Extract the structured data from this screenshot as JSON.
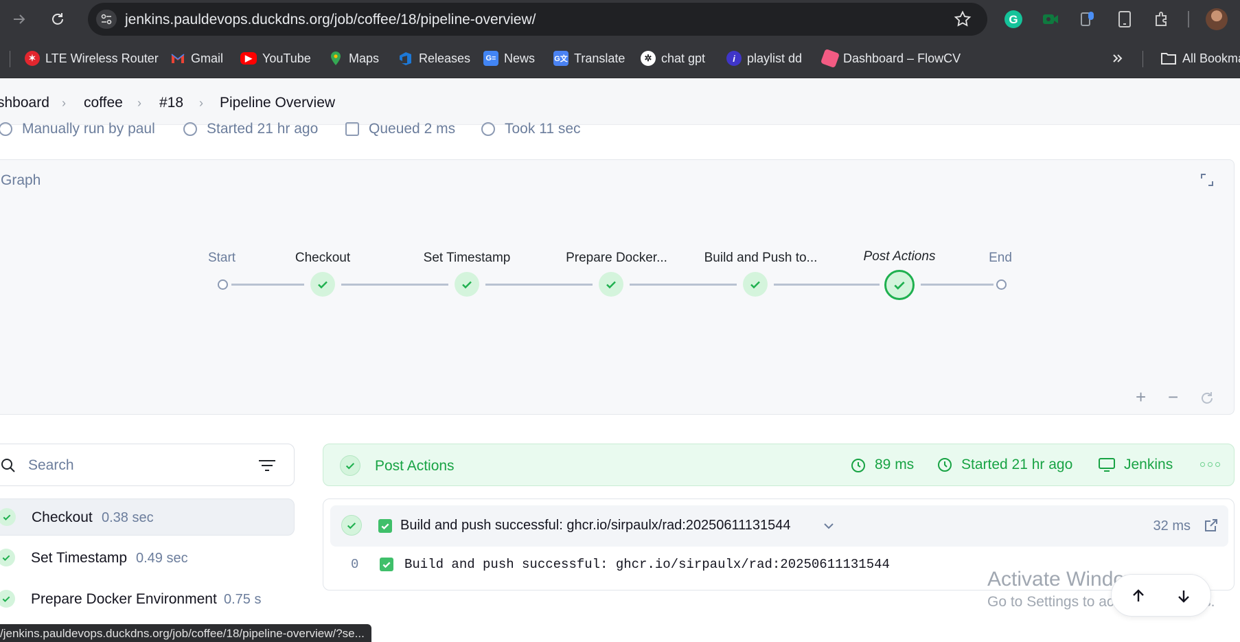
{
  "browser": {
    "url": "jenkins.pauldevops.duckdns.org/job/coffee/18/pipeline-overview/",
    "bookmarks": [
      {
        "label": "LTE Wireless Router",
        "icon": "router-bookmark-icon",
        "color": "#e3262e"
      },
      {
        "label": "Gmail",
        "icon": "gmail-icon",
        "color": "#ea4335"
      },
      {
        "label": "YouTube",
        "icon": "youtube-icon",
        "color": "#ff0000"
      },
      {
        "label": "Maps",
        "icon": "maps-icon",
        "color": "#34a853"
      },
      {
        "label": "Releases",
        "icon": "azure-devops-icon",
        "color": "#1d78d6"
      },
      {
        "label": "News",
        "icon": "google-news-icon",
        "color": "#4285f4"
      },
      {
        "label": "Translate",
        "icon": "google-translate-icon",
        "color": "#4a82f2"
      },
      {
        "label": "chat gpt",
        "icon": "chatgpt-icon",
        "color": "#ffffff"
      },
      {
        "label": "playlist dd",
        "icon": "playlist-icon",
        "color": "#3f35c8"
      },
      {
        "label": "Dashboard – FlowCV",
        "icon": "flowcv-icon",
        "color": "#f35b83"
      }
    ],
    "all_bookmarks_label": "All Bookmarks",
    "status_url": "/jenkins.pauldevops.duckdns.org/job/coffee/18/pipeline-overview/?se..."
  },
  "breadcrumb": [
    "shboard",
    "coffee",
    "#18",
    "Pipeline Overview"
  ],
  "run_meta": {
    "run_by": "Manually run by paul",
    "started": "Started 21 hr ago",
    "queued": "Queued 2 ms",
    "took": "Took 11 sec"
  },
  "graph": {
    "title": "Graph",
    "stages": [
      {
        "label": "Start",
        "kind": "start"
      },
      {
        "label": "Checkout",
        "kind": "success"
      },
      {
        "label": "Set Timestamp",
        "kind": "success"
      },
      {
        "label": "Prepare Docker...",
        "kind": "success"
      },
      {
        "label": "Build and Push to...",
        "kind": "success"
      },
      {
        "label": "Post Actions",
        "kind": "selected"
      },
      {
        "label": "End",
        "kind": "end"
      }
    ],
    "zoom_in": "+",
    "zoom_out": "−"
  },
  "search": {
    "placeholder": "Search"
  },
  "stage_list": [
    {
      "name": "Checkout",
      "duration": "0.38 sec"
    },
    {
      "name": "Set Timestamp",
      "duration": "0.49 sec"
    },
    {
      "name": "Prepare Docker Environment",
      "duration": "0.75 s"
    }
  ],
  "detail": {
    "title": "Post Actions",
    "duration": "89 ms",
    "started": "Started 21 hr ago",
    "agent": "Jenkins",
    "step_message": "Build and push successful: ghcr.io/sirpaulx/rad:20250611131544",
    "step_duration": "32 ms",
    "log_line_number": "0",
    "log_line_text": "Build and push successful: ghcr.io/sirpaulx/rad:20250611131544"
  },
  "watermark": {
    "line1": "Activate Windows",
    "line2": "Go to Settings to activate Windows."
  },
  "colors": {
    "success": "#1fb04f",
    "accent_bg": "#e9faef",
    "muted": "#6b7d9c"
  }
}
